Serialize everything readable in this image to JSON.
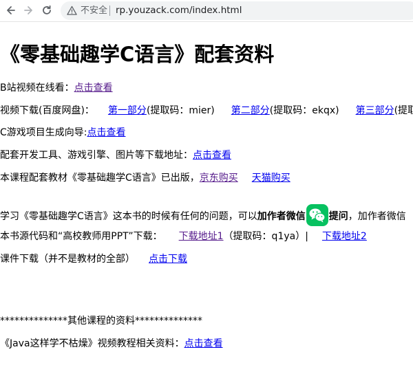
{
  "browser": {
    "security_label": "不安全",
    "url": "rp.youzack.com/index.html"
  },
  "page": {
    "title": "《零基础趣学C语言》配套资料",
    "bili": {
      "prefix": "B站视频在线看：",
      "link": "点击查看"
    },
    "download": {
      "prefix": "视频下载(百度网盘)：",
      "part1": "第一部分",
      "code1": "(提取码：mier)",
      "part2": "第二部分",
      "code2": "(提取码：ekqx)",
      "part3": "第三部分",
      "code3": "(提取码"
    },
    "game": {
      "prefix": "C游戏项目生成向导:",
      "link": "点击查看"
    },
    "tools": {
      "prefix": "配套开发工具、游戏引擎、图片等下载地址：",
      "link": "点击查看"
    },
    "book": {
      "prefix": "本课程配套教材《零基础趣学C语言》已出版，",
      "jd": "京东购买",
      "tmall": "天猫购买"
    },
    "question": {
      "prefix": "学习《零基础趣学C语言》这本书的时候有任何的问题，可以",
      "bold1": "加作者微信",
      "bold2": "提问",
      "suffix": "，加作者微信"
    },
    "source": {
      "prefix": "本书源代码和“高校教师用PPT”下载：",
      "link1": "下载地址1",
      "code": "（提取码：q1ya）|",
      "link2": "下载地址2"
    },
    "courseware": {
      "prefix": "课件下载（并不是教材的全部）",
      "link": "点击下载"
    },
    "other_heading": "**************其他课程的资料**************",
    "java": {
      "prefix": "《Java这样学不枯燥》视频教程相关资料：",
      "link": "点击查看"
    }
  }
}
